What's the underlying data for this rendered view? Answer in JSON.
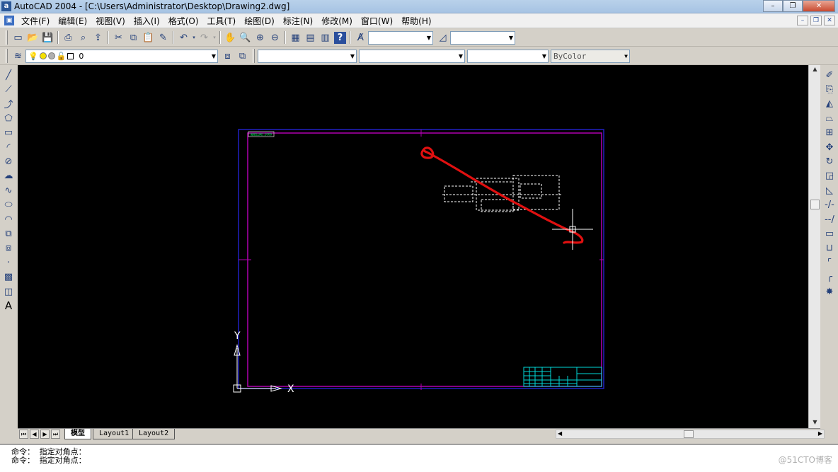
{
  "window": {
    "title": "AutoCAD 2004 - [C:\\Users\\Administrator\\Desktop\\Drawing2.dwg]",
    "app_icon": "a",
    "minimize": "–",
    "restore": "❐",
    "close": "✕"
  },
  "menu": {
    "items": [
      "文件(F)",
      "编辑(E)",
      "视图(V)",
      "插入(I)",
      "格式(O)",
      "工具(T)",
      "绘图(D)",
      "标注(N)",
      "修改(M)",
      "窗口(W)",
      "帮助(H)"
    ]
  },
  "layer": {
    "name": "0"
  },
  "properties": {
    "color": "",
    "linetype": "",
    "lineweight": "",
    "plotstyle": "ByColor"
  },
  "drawing": {
    "title_block_text": "图纸比例1:1000",
    "axis_y": "Y",
    "axis_x": "X"
  },
  "tabs": {
    "model": "模型",
    "layout1": "Layout1",
    "layout2": "Layout2"
  },
  "command": {
    "line1": "命令： 指定对角点：",
    "line2": "命令： 指定对角点："
  },
  "watermark": "@51CTO博客",
  "colors": {
    "canvas": "#000000",
    "paper_border": "#b000b0",
    "outer_border": "#2020c0",
    "annotation": "#e01010",
    "title_block": "#00d8d8",
    "axis": "#ffffff"
  }
}
